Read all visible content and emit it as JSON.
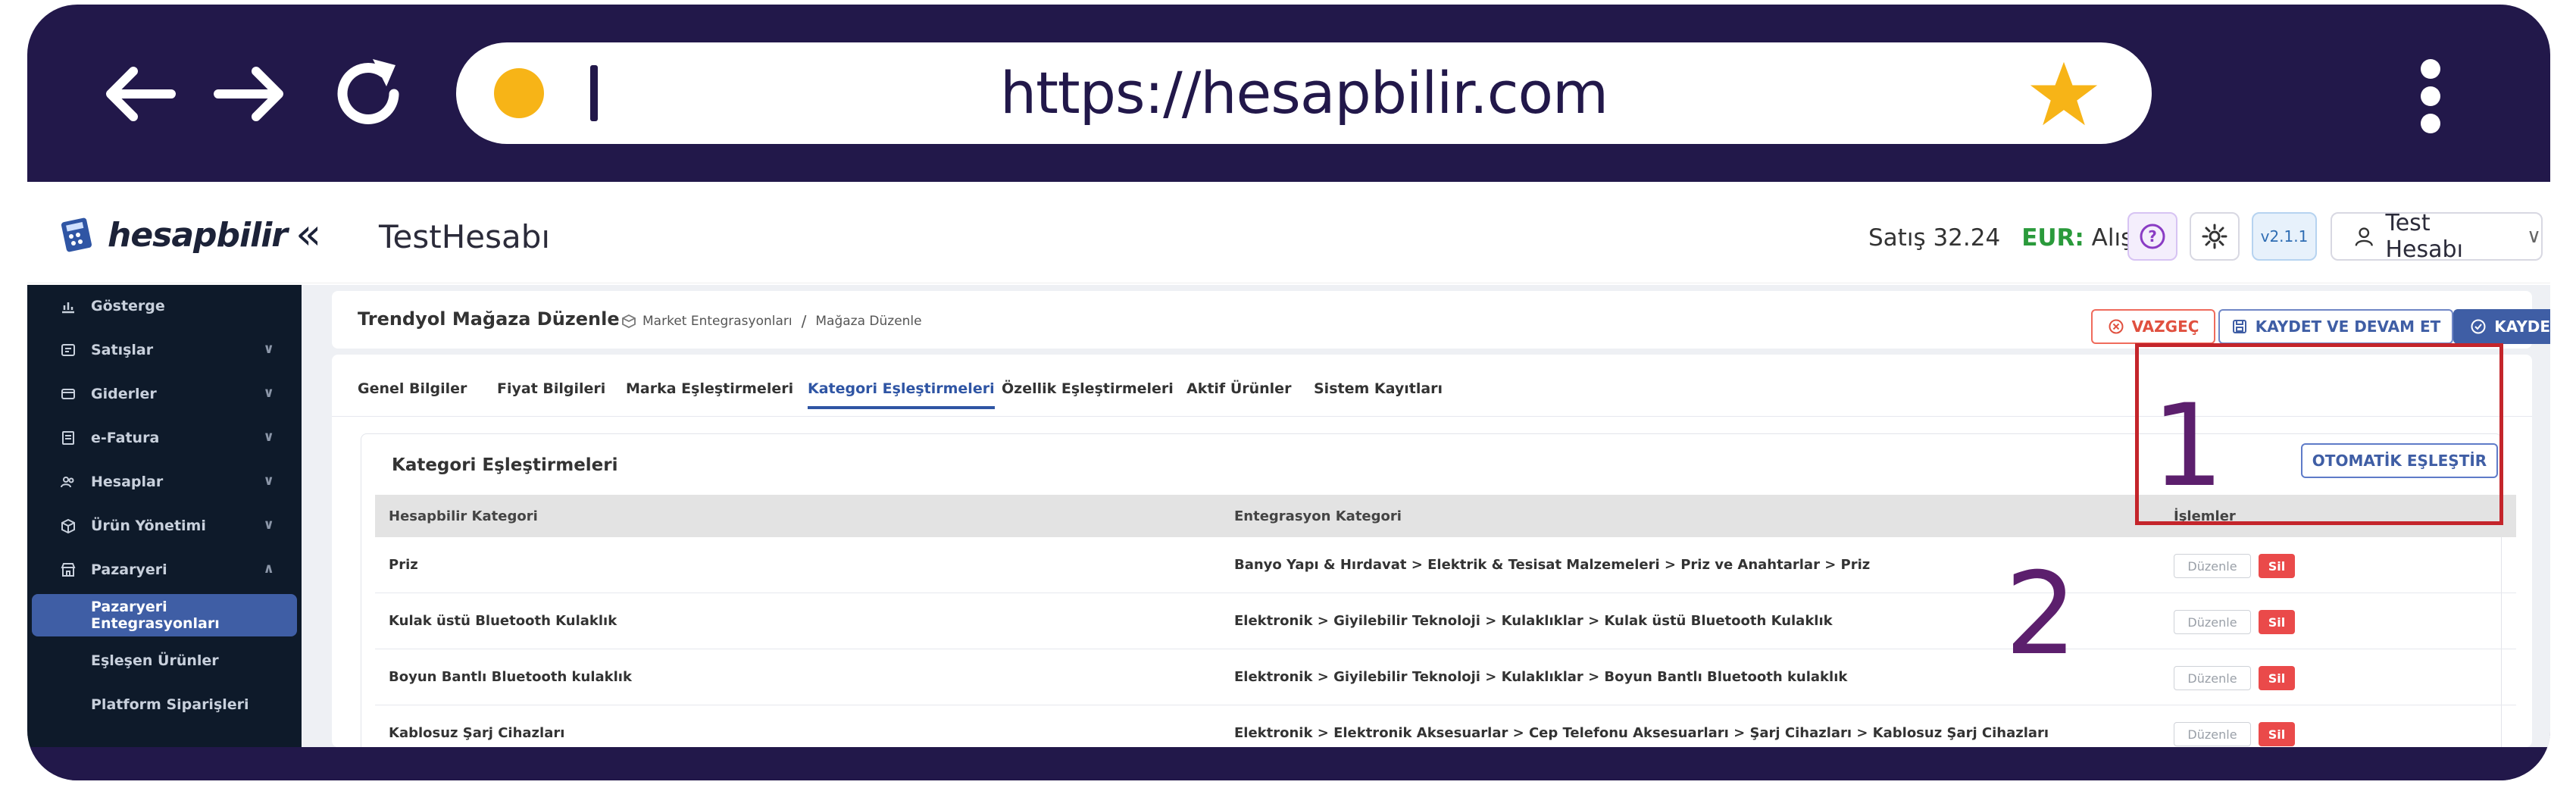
{
  "browser": {
    "url": "https://hesapbilir.com",
    "icons": [
      "back-arrow-icon",
      "forward-arrow-icon",
      "reload-icon",
      "star-icon",
      "kebab-menu-icon"
    ]
  },
  "app": {
    "logo_text": "hesapbilir",
    "company_name": "TestHesabı",
    "rates_text": "Satış 32.24",
    "eur_label": "EUR:",
    "eur_suffix": " Alış",
    "help_label": "?",
    "version_label": "v2.1.1",
    "user_label": "Test Hesabı"
  },
  "sidebar": {
    "items": [
      {
        "label": "Gösterge",
        "icon": "chart-icon"
      },
      {
        "label": "Satışlar",
        "icon": "sales-icon"
      },
      {
        "label": "Giderler",
        "icon": "expenses-icon"
      },
      {
        "label": "e-Fatura",
        "icon": "invoice-icon"
      },
      {
        "label": "Hesaplar",
        "icon": "accounts-icon"
      },
      {
        "label": "Ürün Yönetimi",
        "icon": "box-icon"
      },
      {
        "label": "Pazaryeri",
        "icon": "store-icon"
      }
    ],
    "sub_items": [
      "Pazaryeri Entegrasyonları",
      "Eşleşen Ürünler",
      "Platform Siparişleri"
    ]
  },
  "breadcrumb": {
    "title": "Trendyol Mağaza Düzenle",
    "path_1": "Market Entegrasyonları",
    "separator": "/",
    "path_2": "Mağaza Düzenle"
  },
  "actions": {
    "cancel": "VAZGEÇ",
    "save_continue": "KAYDET VE DEVAM ET",
    "save": "KAYDET"
  },
  "tabs": [
    "Genel Bilgiler",
    "Fiyat Bilgileri",
    "Marka Eşleştirmeleri",
    "Kategori Eşleştirmeleri",
    "Özellik Eşleştirmeleri",
    "Aktif Ürünler",
    "Sistem Kayıtları"
  ],
  "active_tab": "Kategori Eşleştirmeleri",
  "section": {
    "title": "Kategori Eşleştirmeleri",
    "auto_match": "OTOMATİK EŞLEŞTİR",
    "columns": [
      "Hesapbilir Kategori",
      "Entegrasyon Kategori",
      "İşlemler"
    ],
    "rows": [
      {
        "name": "Priz",
        "path": "Banyo Yapı & Hırdavat > Elektrik & Tesisat Malzemeleri > Priz ve Anahtarlar > Priz"
      },
      {
        "name": "Kulak üstü Bluetooth Kulaklık",
        "path": "Elektronik > Giyilebilir Teknoloji > Kulaklıklar > Kulak üstü Bluetooth Kulaklık"
      },
      {
        "name": "Boyun Bantlı Bluetooth kulaklık",
        "path": "Elektronik > Giyilebilir Teknoloji > Kulaklıklar > Boyun Bantlı Bluetooth kulaklık"
      },
      {
        "name": "Kablosuz Şarj Cihazları",
        "path": "Elektronik > Elektronik Aksesuarlar > Cep Telefonu Aksesuarları > Şarj Cihazları > Kablosuz Şarj Cihazları"
      }
    ],
    "edit_label": "Düzenle",
    "delete_label": "Sil"
  },
  "annotations": {
    "one": "1",
    "two": "2",
    "box_color": "#c4252b",
    "number_color": "#5c1f6d"
  },
  "colors": {
    "frame": "#22184a",
    "accent": "#3f5ea5",
    "sidebar": "#0e1a2a",
    "danger": "#ea4a4a"
  }
}
